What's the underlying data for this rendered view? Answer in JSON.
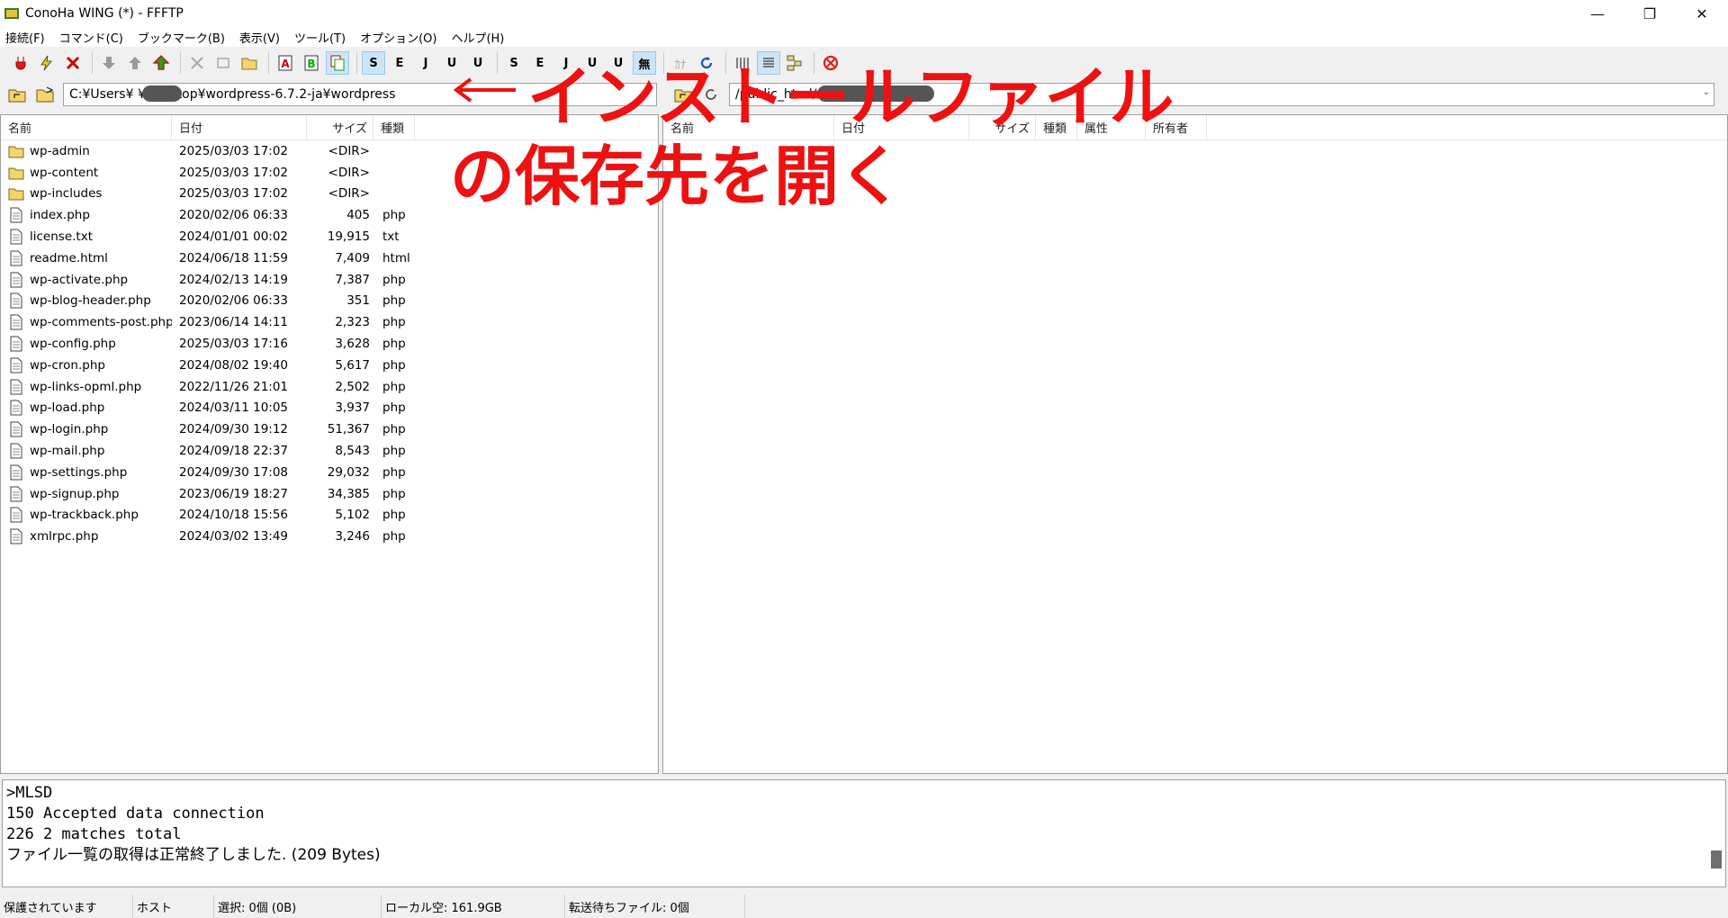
{
  "window": {
    "title": "ConoHa WING (*) - FFFTP",
    "min": "—",
    "max": "❐",
    "close": "✕"
  },
  "menu": [
    "接続(F)",
    "コマンド(C)",
    "ブックマーク(B)",
    "表示(V)",
    "ツール(T)",
    "オプション(O)",
    "ヘルプ(H)"
  ],
  "toolbar": {
    "kanji_labels": [
      "S",
      "E",
      "J",
      "U",
      "U"
    ],
    "kanji_labels2": [
      "S",
      "E",
      "J",
      "U",
      "U",
      "無"
    ],
    "kana": "ｶﾅ"
  },
  "local_path": "C:¥Users¥     ¥Desktop¥wordpress-6.7.2-ja¥wordpress",
  "remote_path": "/public_html/",
  "local_columns": [
    "名前",
    "日付",
    "サイズ",
    "種類"
  ],
  "remote_columns": [
    "名前",
    "日付",
    "サイズ",
    "種類",
    "属性",
    "所有者"
  ],
  "local_files": [
    {
      "name": "wp-admin",
      "date": "2025/03/03 17:02",
      "size": "<DIR>",
      "type": "",
      "kind": "folder"
    },
    {
      "name": "wp-content",
      "date": "2025/03/03 17:02",
      "size": "<DIR>",
      "type": "",
      "kind": "folder"
    },
    {
      "name": "wp-includes",
      "date": "2025/03/03 17:02",
      "size": "<DIR>",
      "type": "",
      "kind": "folder"
    },
    {
      "name": "index.php",
      "date": "2020/02/06 06:33",
      "size": "405",
      "type": "php",
      "kind": "file"
    },
    {
      "name": "license.txt",
      "date": "2024/01/01 00:02",
      "size": "19,915",
      "type": "txt",
      "kind": "file"
    },
    {
      "name": "readme.html",
      "date": "2024/06/18 11:59",
      "size": "7,409",
      "type": "html",
      "kind": "file"
    },
    {
      "name": "wp-activate.php",
      "date": "2024/02/13 14:19",
      "size": "7,387",
      "type": "php",
      "kind": "file"
    },
    {
      "name": "wp-blog-header.php",
      "date": "2020/02/06 06:33",
      "size": "351",
      "type": "php",
      "kind": "file"
    },
    {
      "name": "wp-comments-post.php",
      "date": "2023/06/14 14:11",
      "size": "2,323",
      "type": "php",
      "kind": "file"
    },
    {
      "name": "wp-config.php",
      "date": "2025/03/03 17:16",
      "size": "3,628",
      "type": "php",
      "kind": "file"
    },
    {
      "name": "wp-cron.php",
      "date": "2024/08/02 19:40",
      "size": "5,617",
      "type": "php",
      "kind": "file"
    },
    {
      "name": "wp-links-opml.php",
      "date": "2022/11/26 21:01",
      "size": "2,502",
      "type": "php",
      "kind": "file"
    },
    {
      "name": "wp-load.php",
      "date": "2024/03/11 10:05",
      "size": "3,937",
      "type": "php",
      "kind": "file"
    },
    {
      "name": "wp-login.php",
      "date": "2024/09/30 19:12",
      "size": "51,367",
      "type": "php",
      "kind": "file"
    },
    {
      "name": "wp-mail.php",
      "date": "2024/09/18 22:37",
      "size": "8,543",
      "type": "php",
      "kind": "file"
    },
    {
      "name": "wp-settings.php",
      "date": "2024/09/30 17:08",
      "size": "29,032",
      "type": "php",
      "kind": "file"
    },
    {
      "name": "wp-signup.php",
      "date": "2023/06/19 18:27",
      "size": "34,385",
      "type": "php",
      "kind": "file"
    },
    {
      "name": "wp-trackback.php",
      "date": "2024/10/18 15:56",
      "size": "5,102",
      "type": "php",
      "kind": "file"
    },
    {
      "name": "xmlrpc.php",
      "date": "2024/03/02 13:49",
      "size": "3,246",
      "type": "php",
      "kind": "file"
    }
  ],
  "log": [
    ">MLSD",
    "150 Accepted data connection",
    "226 2 matches total",
    "ファイル一覧の取得は正常終了しました. (209 Bytes)"
  ],
  "status": [
    "保護されています",
    "ホスト",
    "選択: 0個 (0B)",
    "ローカル空: 161.9GB",
    "転送待ちファイル: 0個"
  ],
  "annotation": {
    "line1": "インストールファイル",
    "line2": "の保存先を開く"
  },
  "colors": {
    "annotation": "#ee1111",
    "folder": "#f5d46c"
  }
}
